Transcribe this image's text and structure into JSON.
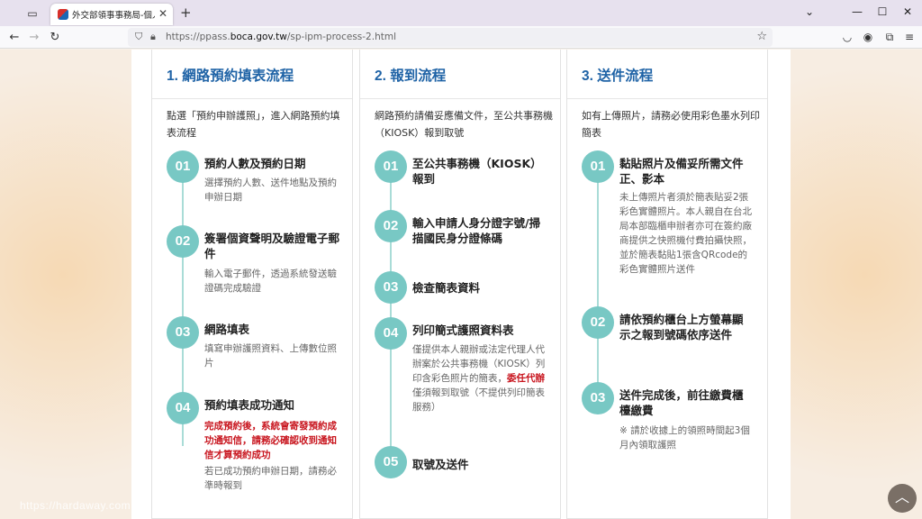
{
  "browser": {
    "tab_title": "外交部領事事務局-個人申辦護照",
    "url_prefix": "https://ppass.",
    "url_domain": "boca.gov.tw",
    "url_path": "/sp-ipm-process-2.html"
  },
  "columns": [
    {
      "title": "1. 網路預約填表流程",
      "intro": "點選「預約申辦護照」，進入網路預約填表流程",
      "steps": [
        {
          "num": "01",
          "title": "預約人數及預約日期",
          "desc": "選擇預約人數、送件地點及預約申辦日期",
          "red": "",
          "desc2": ""
        },
        {
          "num": "02",
          "title": "簽署個資聲明及驗證電子郵件",
          "desc": "輸入電子郵件，透過系統發送驗證碼完成驗證",
          "red": "",
          "desc2": ""
        },
        {
          "num": "03",
          "title": "網路填表",
          "desc": "填寫申辦護照資料、上傳數位照片",
          "red": "",
          "desc2": ""
        },
        {
          "num": "04",
          "title": "預約填表成功通知",
          "desc": "",
          "red": "完成預約後，系統會寄發預約成功通知信，請務必確認收到通知信才算預約成功",
          "desc2": "若已成功預約申辦日期，請務必準時報到"
        }
      ]
    },
    {
      "title": "2. 報到流程",
      "intro": "網路預約請備妥應備文件，至公共事務機（KIOSK）報到取號",
      "steps": [
        {
          "num": "01",
          "title": "至公共事務機（KIOSK）報到",
          "desc": ""
        },
        {
          "num": "02",
          "title": "輸入申請人身分證字號/掃描國民身分證條碼",
          "desc": ""
        },
        {
          "num": "03",
          "title": "檢查簡表資料",
          "desc": ""
        },
        {
          "num": "04",
          "title": "列印簡式護照資料表",
          "desc_a": "僅提供本人親辦或法定代理人代辦案於公共事務機（KIOSK）列印含彩色照片的簡表，",
          "desc_red": "委任代辦",
          "desc_b": "僅須報到取號（不提供列印簡表服務）"
        },
        {
          "num": "05",
          "title": "取號及送件",
          "desc": ""
        }
      ]
    },
    {
      "title": "3. 送件流程",
      "intro": "如有上傳照片，請務必使用彩色墨水列印簡表",
      "steps": [
        {
          "num": "01",
          "title": "黏貼照片及備妥所需文件正、影本",
          "desc": "未上傳照片者須於簡表貼妥2張彩色實體照片。本人親自在台北局本部臨櫃申辦者亦可在簽約廠商提供之快照機付費拍攝快照，並於簡表黏貼1張含QRcode的彩色實體照片送件"
        },
        {
          "num": "02",
          "title": "請依預約櫃台上方螢幕顯示之報到號碼依序送件",
          "desc": ""
        },
        {
          "num": "03",
          "title": "送件完成後，前往繳費櫃檯繳費",
          "desc": "※ 請於收據上的領照時間起3個月內領取護照"
        }
      ]
    }
  ],
  "watermark": "https://hardaway.com",
  "back_to_top": "︿"
}
